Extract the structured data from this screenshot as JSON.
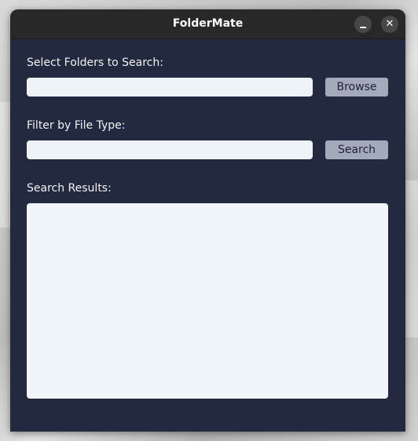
{
  "window": {
    "title": "FolderMate",
    "minimize_icon": "minimize-icon",
    "close_icon": "close-icon",
    "close_glyph": "✕"
  },
  "folders": {
    "label": "Select Folders to Search:",
    "value": "",
    "browse_label": "Browse"
  },
  "filter": {
    "label": "Filter by File Type:",
    "value": "",
    "search_label": "Search"
  },
  "results": {
    "label": "Search Results:",
    "items": []
  },
  "colors": {
    "window_bg": "#222a40",
    "titlebar_bg": "#282828",
    "button_bg": "#a3aabb",
    "field_bg": "#eef3f8"
  }
}
